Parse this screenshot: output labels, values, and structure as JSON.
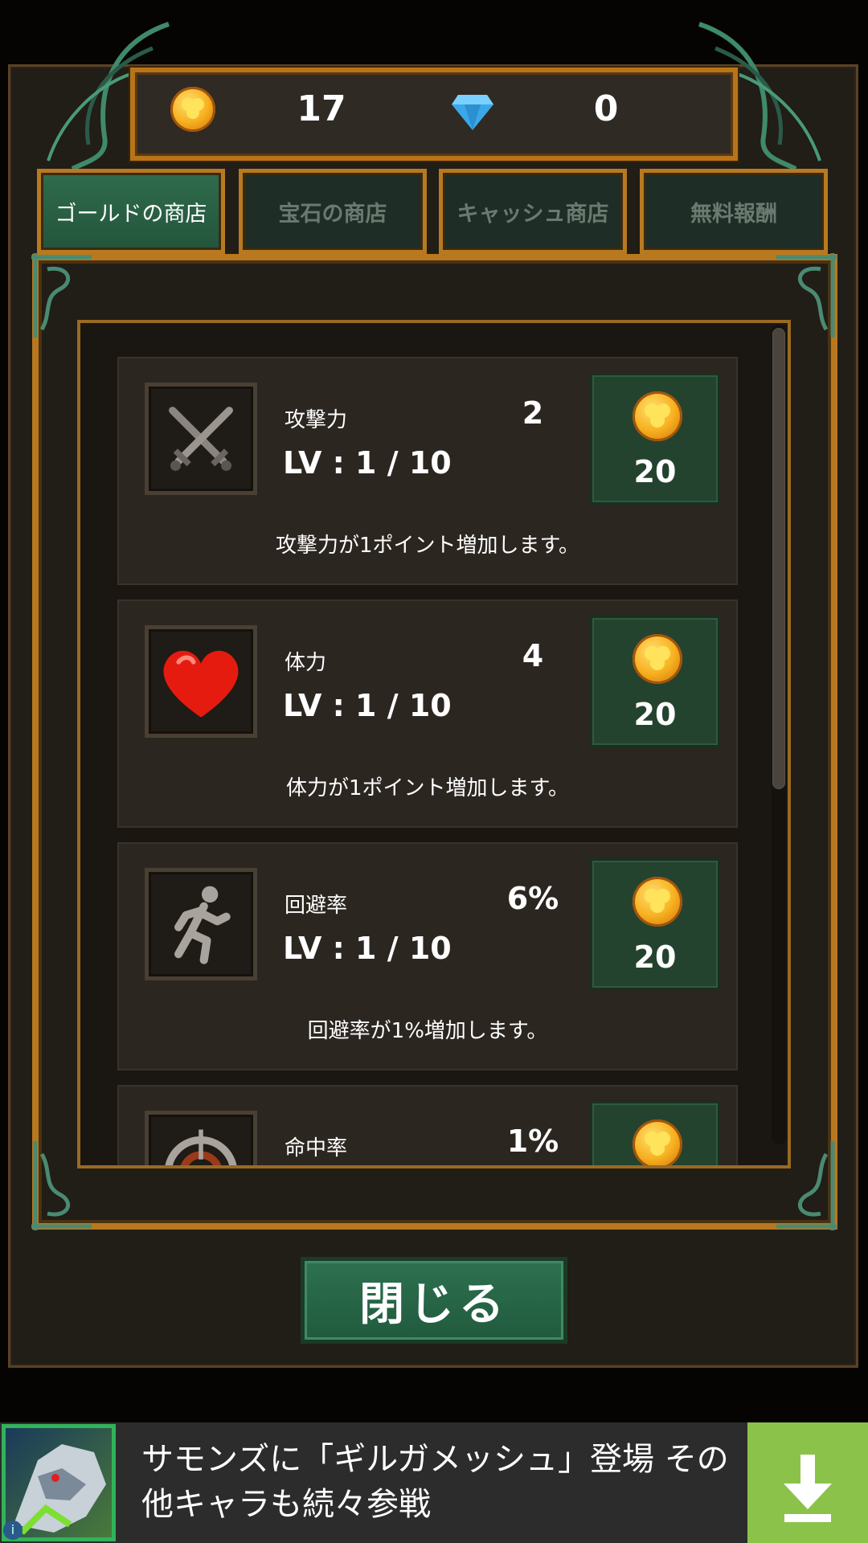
{
  "currency": {
    "gold_icon": "gold-coin-icon",
    "gold_amount": "17",
    "gem_icon": "diamond-icon",
    "gem_amount": "0"
  },
  "tabs": [
    {
      "label": "ゴールドの商店",
      "active": true
    },
    {
      "label": "宝石の商店",
      "active": false
    },
    {
      "label": "キャッシュ商店",
      "active": false
    },
    {
      "label": "無料報酬",
      "active": false
    }
  ],
  "items": [
    {
      "icon": "crossed-swords-icon",
      "name": "攻撃力",
      "value": "2",
      "level": "LV : 1 / 10",
      "price": "20",
      "description": "攻撃力が1ポイント増加します。"
    },
    {
      "icon": "heart-icon",
      "name": "体力",
      "value": "4",
      "level": "LV : 1 / 10",
      "price": "20",
      "description": "体力が1ポイント増加します。"
    },
    {
      "icon": "running-man-icon",
      "name": "回避率",
      "value": "6%",
      "level": "LV : 1 / 10",
      "price": "20",
      "description": "回避率が1%増加します。"
    },
    {
      "icon": "target-icon",
      "name": "命中率",
      "value": "1%",
      "level": "",
      "price": "",
      "description": ""
    }
  ],
  "close_label": "閉じる",
  "ad": {
    "text": "サモンズに「ギルガメッシュ」登場 その他キャラも続々参戦",
    "download_icon": "download-icon",
    "info_icon": "info-icon"
  },
  "colors": {
    "frame_gold": "#b8781f",
    "button_green": "#2d7150",
    "ad_green": "#8bc34a"
  }
}
